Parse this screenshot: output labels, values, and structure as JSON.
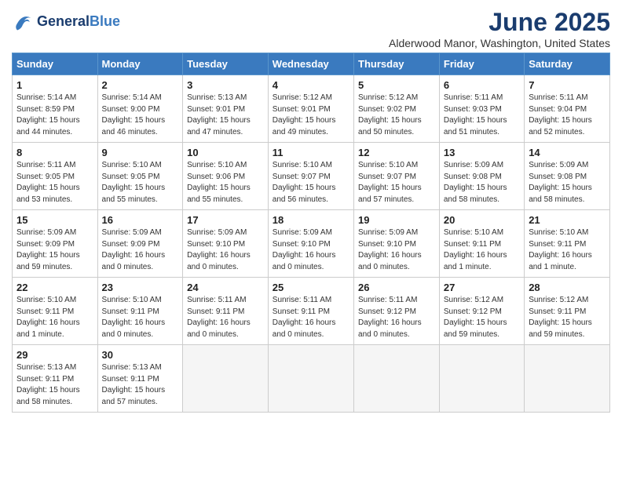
{
  "logo": {
    "line1": "General",
    "line2": "Blue"
  },
  "title": "June 2025",
  "location": "Alderwood Manor, Washington, United States",
  "weekdays": [
    "Sunday",
    "Monday",
    "Tuesday",
    "Wednesday",
    "Thursday",
    "Friday",
    "Saturday"
  ],
  "weeks": [
    [
      {
        "day": 1,
        "info": "Sunrise: 5:14 AM\nSunset: 8:59 PM\nDaylight: 15 hours\nand 44 minutes."
      },
      {
        "day": 2,
        "info": "Sunrise: 5:14 AM\nSunset: 9:00 PM\nDaylight: 15 hours\nand 46 minutes."
      },
      {
        "day": 3,
        "info": "Sunrise: 5:13 AM\nSunset: 9:01 PM\nDaylight: 15 hours\nand 47 minutes."
      },
      {
        "day": 4,
        "info": "Sunrise: 5:12 AM\nSunset: 9:01 PM\nDaylight: 15 hours\nand 49 minutes."
      },
      {
        "day": 5,
        "info": "Sunrise: 5:12 AM\nSunset: 9:02 PM\nDaylight: 15 hours\nand 50 minutes."
      },
      {
        "day": 6,
        "info": "Sunrise: 5:11 AM\nSunset: 9:03 PM\nDaylight: 15 hours\nand 51 minutes."
      },
      {
        "day": 7,
        "info": "Sunrise: 5:11 AM\nSunset: 9:04 PM\nDaylight: 15 hours\nand 52 minutes."
      }
    ],
    [
      {
        "day": 8,
        "info": "Sunrise: 5:11 AM\nSunset: 9:05 PM\nDaylight: 15 hours\nand 53 minutes."
      },
      {
        "day": 9,
        "info": "Sunrise: 5:10 AM\nSunset: 9:05 PM\nDaylight: 15 hours\nand 55 minutes."
      },
      {
        "day": 10,
        "info": "Sunrise: 5:10 AM\nSunset: 9:06 PM\nDaylight: 15 hours\nand 55 minutes."
      },
      {
        "day": 11,
        "info": "Sunrise: 5:10 AM\nSunset: 9:07 PM\nDaylight: 15 hours\nand 56 minutes."
      },
      {
        "day": 12,
        "info": "Sunrise: 5:10 AM\nSunset: 9:07 PM\nDaylight: 15 hours\nand 57 minutes."
      },
      {
        "day": 13,
        "info": "Sunrise: 5:09 AM\nSunset: 9:08 PM\nDaylight: 15 hours\nand 58 minutes."
      },
      {
        "day": 14,
        "info": "Sunrise: 5:09 AM\nSunset: 9:08 PM\nDaylight: 15 hours\nand 58 minutes."
      }
    ],
    [
      {
        "day": 15,
        "info": "Sunrise: 5:09 AM\nSunset: 9:09 PM\nDaylight: 15 hours\nand 59 minutes."
      },
      {
        "day": 16,
        "info": "Sunrise: 5:09 AM\nSunset: 9:09 PM\nDaylight: 16 hours\nand 0 minutes."
      },
      {
        "day": 17,
        "info": "Sunrise: 5:09 AM\nSunset: 9:10 PM\nDaylight: 16 hours\nand 0 minutes."
      },
      {
        "day": 18,
        "info": "Sunrise: 5:09 AM\nSunset: 9:10 PM\nDaylight: 16 hours\nand 0 minutes."
      },
      {
        "day": 19,
        "info": "Sunrise: 5:09 AM\nSunset: 9:10 PM\nDaylight: 16 hours\nand 0 minutes."
      },
      {
        "day": 20,
        "info": "Sunrise: 5:10 AM\nSunset: 9:11 PM\nDaylight: 16 hours\nand 1 minute."
      },
      {
        "day": 21,
        "info": "Sunrise: 5:10 AM\nSunset: 9:11 PM\nDaylight: 16 hours\nand 1 minute."
      }
    ],
    [
      {
        "day": 22,
        "info": "Sunrise: 5:10 AM\nSunset: 9:11 PM\nDaylight: 16 hours\nand 1 minute."
      },
      {
        "day": 23,
        "info": "Sunrise: 5:10 AM\nSunset: 9:11 PM\nDaylight: 16 hours\nand 0 minutes."
      },
      {
        "day": 24,
        "info": "Sunrise: 5:11 AM\nSunset: 9:11 PM\nDaylight: 16 hours\nand 0 minutes."
      },
      {
        "day": 25,
        "info": "Sunrise: 5:11 AM\nSunset: 9:11 PM\nDaylight: 16 hours\nand 0 minutes."
      },
      {
        "day": 26,
        "info": "Sunrise: 5:11 AM\nSunset: 9:12 PM\nDaylight: 16 hours\nand 0 minutes."
      },
      {
        "day": 27,
        "info": "Sunrise: 5:12 AM\nSunset: 9:12 PM\nDaylight: 15 hours\nand 59 minutes."
      },
      {
        "day": 28,
        "info": "Sunrise: 5:12 AM\nSunset: 9:11 PM\nDaylight: 15 hours\nand 59 minutes."
      }
    ],
    [
      {
        "day": 29,
        "info": "Sunrise: 5:13 AM\nSunset: 9:11 PM\nDaylight: 15 hours\nand 58 minutes."
      },
      {
        "day": 30,
        "info": "Sunrise: 5:13 AM\nSunset: 9:11 PM\nDaylight: 15 hours\nand 57 minutes."
      },
      null,
      null,
      null,
      null,
      null
    ]
  ]
}
